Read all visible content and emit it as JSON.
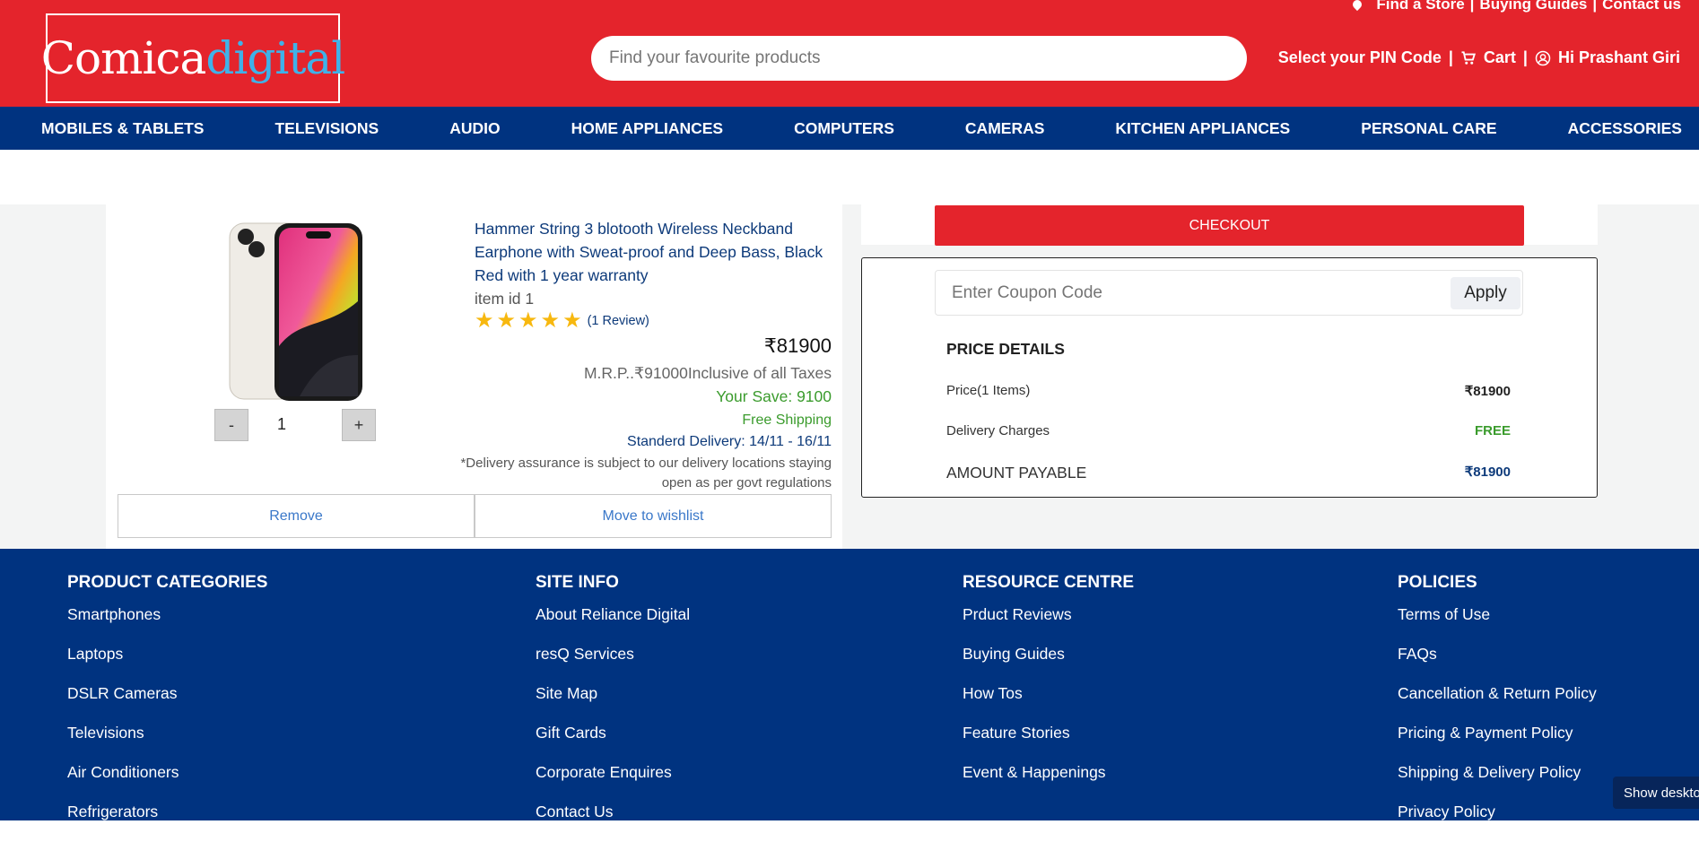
{
  "brand": {
    "part1": "Comica",
    "part2": "digital"
  },
  "top_links": [
    "Find a Store",
    "Buying Guides",
    "Contact us"
  ],
  "search": {
    "placeholder": "Find your favourite products"
  },
  "header_right": {
    "pin": "Select your PIN Code",
    "cart": "Cart",
    "user": "Hi Prashant Giri"
  },
  "nav": [
    "MOBILES & TABLETS",
    "TELEVISIONS",
    "AUDIO",
    "HOME APPLIANCES",
    "COMPUTERS",
    "CAMERAS",
    "KITCHEN APPLIANCES",
    "PERSONAL CARE",
    "ACCESSORIES"
  ],
  "cart_item": {
    "title": "Hammer String 3 blotooth Wireless Neckband Earphone with Sweat-proof and Deep Bass, Black Red with 1 year warranty",
    "item_id": "item id 1",
    "rating": 5,
    "review_count": "(1 Review)",
    "price": "₹81900",
    "mrp": "M.R.P..₹91000Inclusive of all Taxes",
    "save": "Your Save: 9100",
    "shipping": "Free Shipping",
    "delivery": "Standerd Delivery: 14/11 - 16/11",
    "note": "*Delivery assurance is subject to our delivery locations staying open as per govt regulations",
    "qty": "1",
    "qty_minus": "-",
    "qty_plus": "+",
    "remove": "Remove",
    "wishlist": "Move to wishlist"
  },
  "checkout": {
    "label": "CHECKOUT"
  },
  "coupon": {
    "placeholder": "Enter Coupon Code",
    "apply": "Apply"
  },
  "price_details": {
    "title": "PRICE DETAILS",
    "price_label": "Price(1 Items)",
    "price_value": "₹81900",
    "delivery_label": "Delivery Charges",
    "delivery_value": "FREE",
    "payable_label": "AMOUNT PAYABLE",
    "payable_value": "₹81900"
  },
  "footer": {
    "columns": [
      {
        "heading": "PRODUCT CATEGORIES",
        "links": [
          "Smartphones",
          "Laptops",
          "DSLR Cameras",
          "Televisions",
          "Air Conditioners",
          "Refrigerators"
        ]
      },
      {
        "heading": "SITE INFO",
        "links": [
          "About Reliance Digital",
          "resQ Services",
          "Site Map",
          "Gift Cards",
          "Corporate Enquires",
          "Contact Us"
        ]
      },
      {
        "heading": "RESOURCE CENTRE",
        "links": [
          "Prduct Reviews",
          "Buying Guides",
          "How Tos",
          "Feature Stories",
          "Event & Happenings"
        ]
      },
      {
        "heading": "POLICIES",
        "links": [
          "Terms of Use",
          "FAQs",
          "Cancellation & Return Policy",
          "Pricing & Payment Policy",
          "Shipping & Delivery Policy",
          "Privacy Policy"
        ]
      }
    ]
  },
  "show_desktop": "Show deskto",
  "colors": {
    "brand_red": "#e4242c",
    "nav_blue": "#003380",
    "accent_green": "#3a9b2c",
    "logo_blue": "#3fb2e9"
  }
}
